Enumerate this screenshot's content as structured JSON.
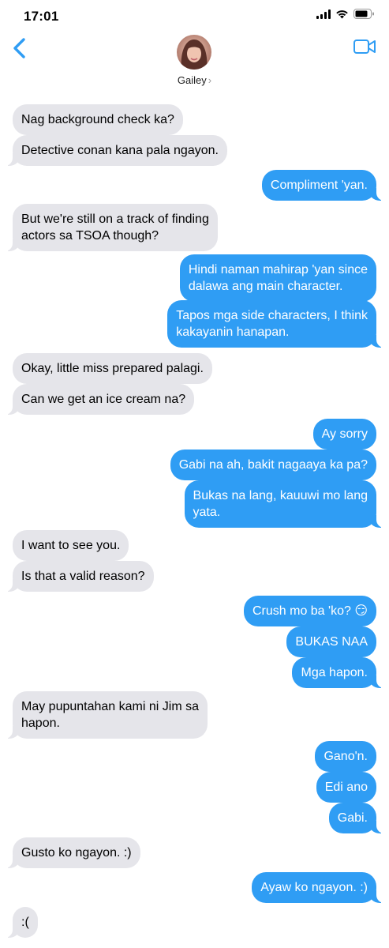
{
  "status_bar": {
    "time": "17:01",
    "icons": [
      "cellular-signal-icon",
      "wifi-icon",
      "battery-icon"
    ]
  },
  "header": {
    "contact_name": "Gailey",
    "chevron": "›",
    "back_icon": "chevron-left-icon",
    "video_icon": "video-camera-icon"
  },
  "colors": {
    "accent": "#2f9df4",
    "incoming_bubble": "#e5e5ea"
  },
  "messages": [
    {
      "dir": "in",
      "lines": [
        "Nag background check ka?"
      ]
    },
    {
      "dir": "in",
      "lines": [
        "Detective conan kana pala ngayon."
      ]
    },
    {
      "dir": "out",
      "lines": [
        "Compliment 'yan."
      ]
    },
    {
      "dir": "in",
      "lines": [
        "But we're still on a track of finding",
        "actors sa TSOA though?"
      ]
    },
    {
      "dir": "out",
      "lines": [
        "Hindi naman mahirap 'yan since",
        "dalawa ang main character."
      ]
    },
    {
      "dir": "out",
      "lines": [
        "Tapos mga side characters, I think",
        "kakayanin hanapan."
      ]
    },
    {
      "dir": "in",
      "lines": [
        "Okay, little miss prepared palagi."
      ]
    },
    {
      "dir": "in",
      "lines": [
        "Can we get an ice cream na?"
      ]
    },
    {
      "dir": "out",
      "lines": [
        "Ay sorry"
      ]
    },
    {
      "dir": "out",
      "lines": [
        "Gabi na ah, bakit nagaaya ka pa?"
      ]
    },
    {
      "dir": "out",
      "lines": [
        "Bukas na lang, kauuwi mo lang",
        "yata."
      ]
    },
    {
      "dir": "in",
      "lines": [
        "I want to see you."
      ]
    },
    {
      "dir": "in",
      "lines": [
        "Is that a valid reason?"
      ]
    },
    {
      "dir": "out",
      "lines": [
        "Crush mo ba 'ko? 😏"
      ]
    },
    {
      "dir": "out",
      "lines": [
        "BUKAS NAA"
      ]
    },
    {
      "dir": "out",
      "lines": [
        "Mga hapon."
      ]
    },
    {
      "dir": "in",
      "lines": [
        "May pupuntahan kami ni Jim sa",
        "hapon."
      ]
    },
    {
      "dir": "out",
      "lines": [
        "Gano'n."
      ]
    },
    {
      "dir": "out",
      "lines": [
        "Edi ano"
      ]
    },
    {
      "dir": "out",
      "lines": [
        "Gabi."
      ]
    },
    {
      "dir": "in",
      "lines": [
        "Gusto ko ngayon. :)"
      ]
    },
    {
      "dir": "out",
      "lines": [
        "Ayaw ko ngayon. :)"
      ]
    },
    {
      "dir": "in",
      "lines": [
        ":("
      ]
    }
  ]
}
